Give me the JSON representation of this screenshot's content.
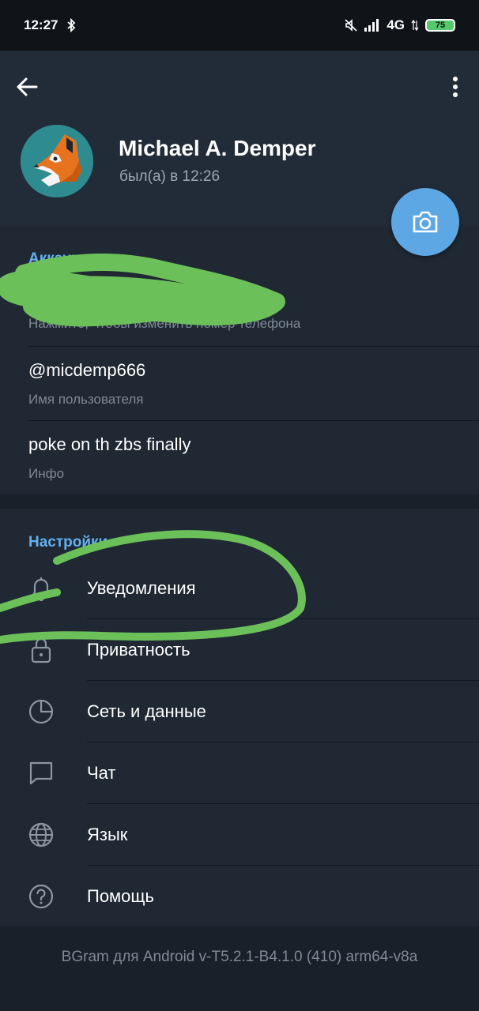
{
  "status_bar": {
    "time": "12:27",
    "network": "4G",
    "battery": "75"
  },
  "profile": {
    "name": "Michael A. Demper",
    "status": "был(а) в 12:26"
  },
  "account": {
    "title": "Аккаунт",
    "phone_hint": "Нажмите, чтобы изменить номер телефона",
    "username": "@micdemp666",
    "username_label": "Имя пользователя",
    "bio": "poke on th zbs finally",
    "bio_label": "Инфо"
  },
  "settings": {
    "title": "Настройки",
    "items": [
      {
        "label": "Уведомления",
        "icon": "bell-icon"
      },
      {
        "label": "Приватность",
        "icon": "lock-icon"
      },
      {
        "label": "Сеть и данные",
        "icon": "data-usage-icon"
      },
      {
        "label": "Чат",
        "icon": "chat-icon"
      },
      {
        "label": "Язык",
        "icon": "globe-icon"
      },
      {
        "label": "Помощь",
        "icon": "help-icon"
      }
    ]
  },
  "footer": {
    "version": "BGram для Android v-T5.2.1-B4.1.0 (410) arm64-v8a"
  },
  "colors": {
    "accent": "#64b0ef",
    "fab": "#5ca7e4",
    "background": "#18202a",
    "surface": "#1f2833",
    "scribble": "#6cc05a"
  }
}
